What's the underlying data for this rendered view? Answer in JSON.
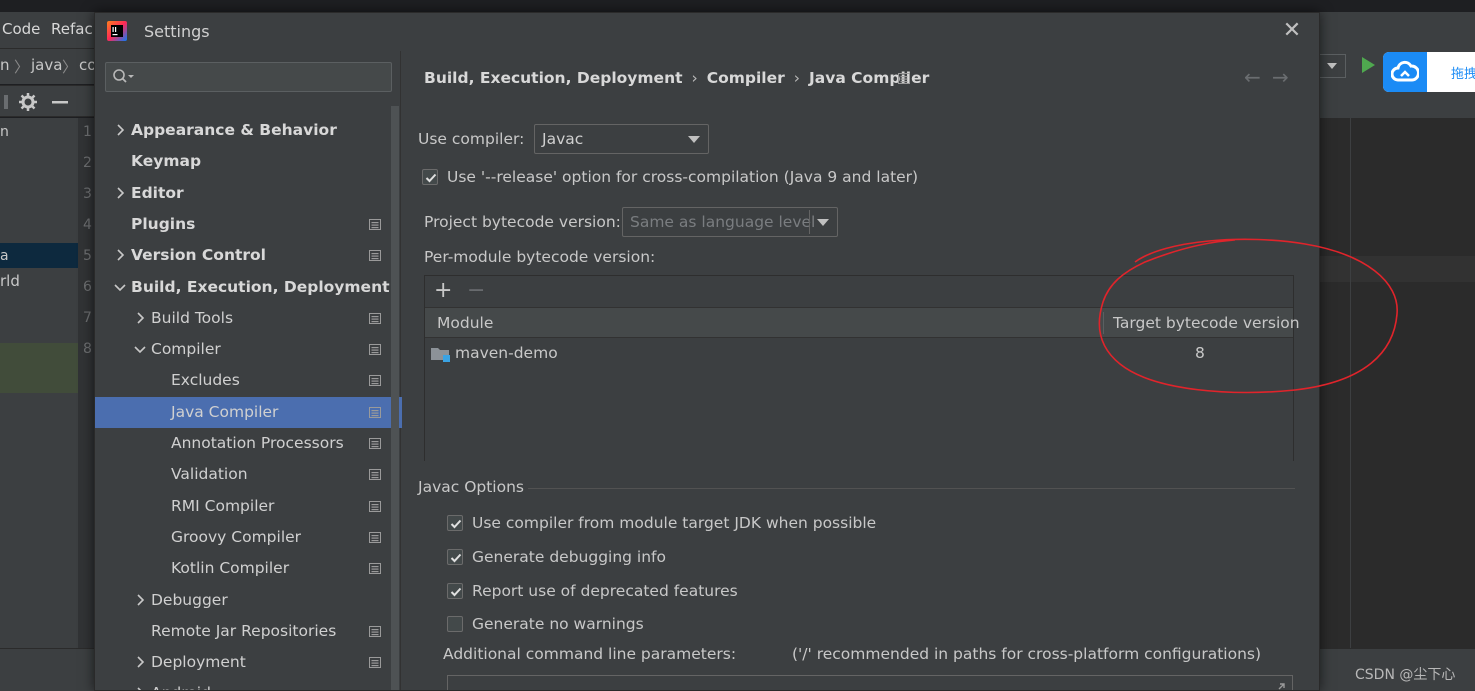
{
  "ide": {
    "menu": [
      "Code",
      "Refac"
    ],
    "breadcrumb": [
      "n",
      "java",
      "co"
    ],
    "project_items": [
      "n",
      "a",
      "rld"
    ],
    "line_numbers": [
      "1",
      "2",
      "3",
      "4",
      "5",
      "6",
      "7",
      "8"
    ],
    "cloud_label": "拖拽",
    "watermark": "CSDN @尘下心"
  },
  "dialog": {
    "title": "Settings",
    "close_glyph": "✕",
    "search": {
      "value": "",
      "placeholder": ""
    },
    "tree": [
      {
        "label": "Appearance & Behavior",
        "bold": true,
        "level": 0,
        "chevron": "right",
        "proj_icon": false,
        "selected": false
      },
      {
        "label": "Keymap",
        "bold": true,
        "level": 0,
        "chevron": "none",
        "proj_icon": false,
        "selected": false
      },
      {
        "label": "Editor",
        "bold": true,
        "level": 0,
        "chevron": "right",
        "proj_icon": false,
        "selected": false
      },
      {
        "label": "Plugins",
        "bold": true,
        "level": 0,
        "chevron": "none",
        "proj_icon": true,
        "selected": false
      },
      {
        "label": "Version Control",
        "bold": true,
        "level": 0,
        "chevron": "right",
        "proj_icon": true,
        "selected": false
      },
      {
        "label": "Build, Execution, Deployment",
        "bold": true,
        "level": 0,
        "chevron": "down",
        "proj_icon": false,
        "selected": false
      },
      {
        "label": "Build Tools",
        "bold": false,
        "level": 1,
        "chevron": "right",
        "proj_icon": true,
        "selected": false
      },
      {
        "label": "Compiler",
        "bold": false,
        "level": 1,
        "chevron": "down",
        "proj_icon": true,
        "selected": false
      },
      {
        "label": "Excludes",
        "bold": false,
        "level": 2,
        "chevron": "none",
        "proj_icon": true,
        "selected": false
      },
      {
        "label": "Java Compiler",
        "bold": false,
        "level": 2,
        "chevron": "none",
        "proj_icon": true,
        "selected": true
      },
      {
        "label": "Annotation Processors",
        "bold": false,
        "level": 2,
        "chevron": "none",
        "proj_icon": true,
        "selected": false
      },
      {
        "label": "Validation",
        "bold": false,
        "level": 2,
        "chevron": "none",
        "proj_icon": true,
        "selected": false
      },
      {
        "label": "RMI Compiler",
        "bold": false,
        "level": 2,
        "chevron": "none",
        "proj_icon": true,
        "selected": false
      },
      {
        "label": "Groovy Compiler",
        "bold": false,
        "level": 2,
        "chevron": "none",
        "proj_icon": true,
        "selected": false
      },
      {
        "label": "Kotlin Compiler",
        "bold": false,
        "level": 2,
        "chevron": "none",
        "proj_icon": true,
        "selected": false
      },
      {
        "label": "Debugger",
        "bold": false,
        "level": 1,
        "chevron": "right",
        "proj_icon": false,
        "selected": false
      },
      {
        "label": "Remote Jar Repositories",
        "bold": false,
        "level": 1,
        "chevron": "none",
        "proj_icon": true,
        "selected": false
      },
      {
        "label": "Deployment",
        "bold": false,
        "level": 1,
        "chevron": "right",
        "proj_icon": true,
        "selected": false
      },
      {
        "label": "Android",
        "bold": false,
        "level": 1,
        "chevron": "right",
        "proj_icon": false,
        "selected": false
      }
    ],
    "content": {
      "breadcrumb": [
        "Build, Execution, Deployment",
        "Compiler",
        "Java Compiler"
      ],
      "breadcrumb_sep": "›",
      "nav_back": "←",
      "nav_forward": "→",
      "use_compiler_label": "Use compiler:",
      "use_compiler_value": "Javac",
      "release_option_label": "Use '--release' option for cross-compilation (Java 9 and later)",
      "release_option_checked": true,
      "project_bytecode_label": "Project bytecode version:",
      "project_bytecode_value": "Same as language level",
      "per_module_label": "Per-module bytecode version:",
      "table": {
        "add_glyph": "+",
        "remove_glyph": "−",
        "columns": [
          "Module",
          "Target bytecode version"
        ],
        "rows": [
          {
            "module": "maven-demo",
            "target": "8"
          }
        ]
      },
      "javac_options_title": "Javac Options",
      "javac_options": [
        {
          "label": "Use compiler from module target JDK when possible",
          "checked": true
        },
        {
          "label": "Generate debugging info",
          "checked": true
        },
        {
          "label": "Report use of deprecated features",
          "checked": true
        },
        {
          "label": "Generate no warnings",
          "checked": false
        }
      ],
      "additional_params_label": "Additional command line parameters:",
      "additional_params_hint": "('/' recommended in paths for cross-platform configurations)",
      "additional_params_value": ""
    }
  },
  "colors": {
    "selection": "#4b6eaf",
    "annotation": "#e0242b",
    "run": "#4fa84f",
    "cloud": "#1b8bf5"
  }
}
